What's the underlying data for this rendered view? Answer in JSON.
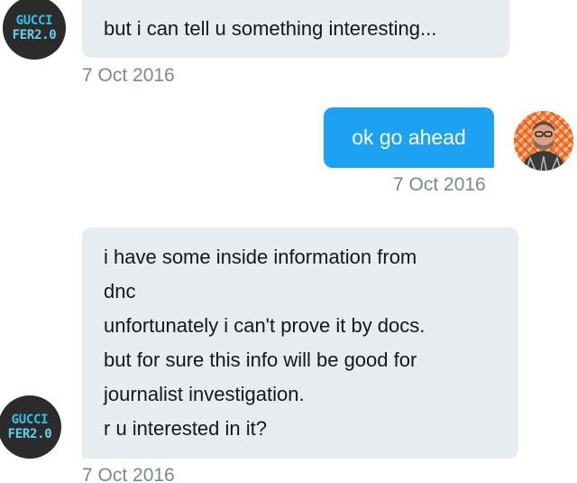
{
  "conversation": {
    "messages": [
      {
        "sender": "other",
        "avatar_text": [
          "GUCCI",
          "FER2.0"
        ],
        "lines": [
          "but i can tell u something interesting..."
        ],
        "timestamp": "7 Oct 2016"
      },
      {
        "sender": "self",
        "lines": [
          "ok go ahead"
        ],
        "timestamp": "7 Oct 2016"
      },
      {
        "sender": "other",
        "avatar_text": [
          "GUCCI",
          "FER2.0"
        ],
        "lines": [
          "i have some inside information from",
          "dnc",
          "unfortunately i can't prove it by docs.",
          "but for sure this info will be good for",
          "journalist investigation.",
          "r u interested in it?"
        ],
        "timestamp": "7 Oct 2016"
      }
    ]
  },
  "colors": {
    "incoming_bubble": "#e6ecf0",
    "outgoing_bubble": "#1da1f2",
    "timestamp": "#7a8893",
    "avatar_text": "#2ec4e8"
  },
  "icons": {
    "gucci_avatar": "avatar-icon",
    "user_avatar": "user-photo-icon"
  }
}
